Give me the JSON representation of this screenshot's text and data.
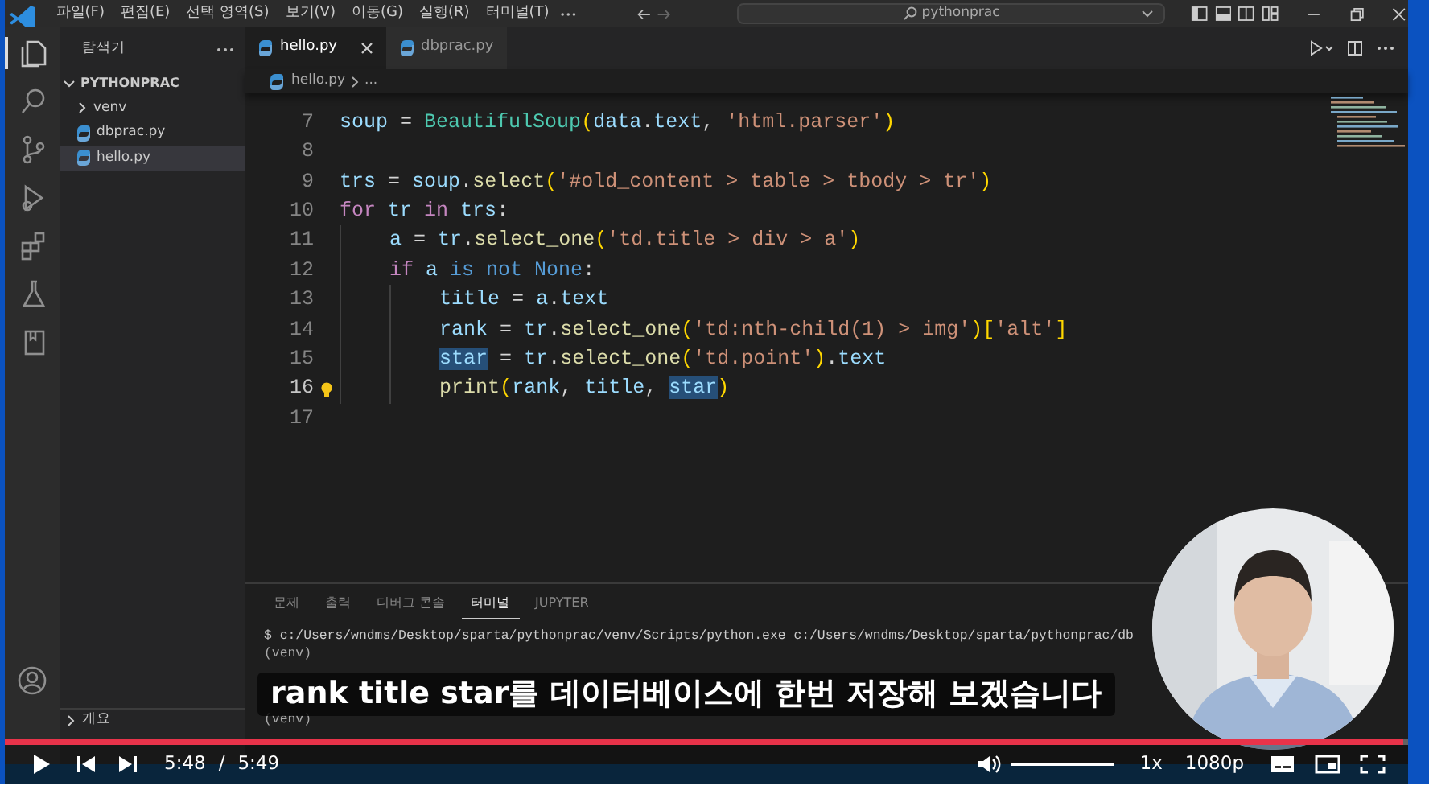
{
  "window": {
    "menu": [
      "파일(F)",
      "편집(E)",
      "선택 영역(S)",
      "보기(V)",
      "이동(G)",
      "실행(R)",
      "터미널(T)"
    ],
    "search": "pythonprac"
  },
  "activity_bar": [
    {
      "kind": "files",
      "selected": true
    },
    {
      "kind": "search",
      "selected": false
    },
    {
      "kind": "branch",
      "selected": false
    },
    {
      "kind": "run",
      "selected": false
    },
    {
      "kind": "blocks",
      "selected": false
    },
    {
      "kind": "flask",
      "selected": false
    },
    {
      "kind": "book",
      "selected": false
    }
  ],
  "explorer": {
    "title": "탐색기",
    "folder": "PYTHONPRAC",
    "expanded": true,
    "items": [
      {
        "label": "venv",
        "kind": "folder",
        "expanded": false,
        "selected": false
      },
      {
        "label": "dbprac.py",
        "kind": "python",
        "selected": false
      },
      {
        "label": "hello.py",
        "kind": "python",
        "selected": true
      }
    ],
    "sections": [
      {
        "label": "개요",
        "expanded": false
      }
    ]
  },
  "tabs": [
    {
      "label": "hello.py",
      "selected": true
    },
    {
      "label": "dbprac.py",
      "selected": false
    }
  ],
  "breadcrumb": {
    "file": "hello.py",
    "rest": "..."
  },
  "code": [
    {
      "no": "7",
      "current": false,
      "lightbulb": false,
      "tokens": [
        {
          "t": "soup",
          "kind": "var"
        },
        {
          "t": " = ",
          "kind": "punct"
        },
        {
          "t": "BeautifulSoup",
          "kind": "class"
        },
        {
          "t": "(",
          "kind": "bracket"
        },
        {
          "t": "data",
          "kind": "var"
        },
        {
          "t": ".",
          "kind": "punct"
        },
        {
          "t": "text",
          "kind": "var"
        },
        {
          "t": ", ",
          "kind": "punct"
        },
        {
          "t": "'html.parser'",
          "kind": "string"
        },
        {
          "t": ")",
          "kind": "bracket"
        }
      ]
    },
    {
      "no": "8",
      "current": false,
      "lightbulb": false
    },
    {
      "no": "9",
      "current": false,
      "lightbulb": false,
      "tokens": [
        {
          "t": "trs",
          "kind": "var"
        },
        {
          "t": " = ",
          "kind": "punct"
        },
        {
          "t": "soup",
          "kind": "var"
        },
        {
          "t": ".",
          "kind": "punct"
        },
        {
          "t": "select",
          "kind": "func"
        },
        {
          "t": "(",
          "kind": "bracket"
        },
        {
          "t": "'#old_content > table > tbody > tr'",
          "kind": "string"
        },
        {
          "t": ")",
          "kind": "bracket"
        }
      ]
    },
    {
      "no": "10",
      "current": false,
      "lightbulb": false,
      "tokens": [
        {
          "t": "for ",
          "kind": "control"
        },
        {
          "t": "tr ",
          "kind": "var"
        },
        {
          "t": "in ",
          "kind": "control"
        },
        {
          "t": "trs",
          "kind": "var"
        },
        {
          "t": ":",
          "kind": "punct"
        }
      ]
    },
    {
      "no": "11",
      "current": false,
      "lightbulb": false,
      "tokens": [
        {
          "t": "    a",
          "kind": "var"
        },
        {
          "t": " = ",
          "kind": "punct"
        },
        {
          "t": "tr",
          "kind": "var"
        },
        {
          "t": ".",
          "kind": "punct"
        },
        {
          "t": "select_one",
          "kind": "func"
        },
        {
          "t": "(",
          "kind": "bracket"
        },
        {
          "t": "'td.title > div > a'",
          "kind": "string"
        },
        {
          "t": ")",
          "kind": "bracket"
        }
      ]
    },
    {
      "no": "12",
      "current": false,
      "lightbulb": false,
      "tokens": [
        {
          "t": "    if ",
          "kind": "control"
        },
        {
          "t": "a ",
          "kind": "var"
        },
        {
          "t": "is not None",
          "kind": "keyword"
        },
        {
          "t": ":",
          "kind": "punct"
        }
      ]
    },
    {
      "no": "13",
      "current": false,
      "lightbulb": false,
      "tokens": [
        {
          "t": "        title",
          "kind": "var"
        },
        {
          "t": " = ",
          "kind": "punct"
        },
        {
          "t": "a",
          "kind": "var"
        },
        {
          "t": ".",
          "kind": "punct"
        },
        {
          "t": "text",
          "kind": "var"
        }
      ]
    },
    {
      "no": "14",
      "current": false,
      "lightbulb": false,
      "tokens": [
        {
          "t": "        rank",
          "kind": "var"
        },
        {
          "t": " = ",
          "kind": "punct"
        },
        {
          "t": "tr",
          "kind": "var"
        },
        {
          "t": ".",
          "kind": "punct"
        },
        {
          "t": "select_one",
          "kind": "func"
        },
        {
          "t": "(",
          "kind": "bracket"
        },
        {
          "t": "'td:nth-child(1) > img'",
          "kind": "string"
        },
        {
          "t": ")[",
          "kind": "bracket"
        },
        {
          "t": "'alt'",
          "kind": "string"
        },
        {
          "t": "]",
          "kind": "bracket"
        }
      ]
    },
    {
      "no": "15",
      "current": false,
      "lightbulb": false,
      "tokens": [
        {
          "t": "        star",
          "kind": "var",
          "highlight": true
        },
        {
          "t": " = ",
          "kind": "punct"
        },
        {
          "t": "tr",
          "kind": "var"
        },
        {
          "t": ".",
          "kind": "punct"
        },
        {
          "t": "select_one",
          "kind": "func"
        },
        {
          "t": "(",
          "kind": "bracket"
        },
        {
          "t": "'td.point'",
          "kind": "string"
        },
        {
          "t": ")",
          "kind": "bracket"
        },
        {
          "t": ".",
          "kind": "punct"
        },
        {
          "t": "text",
          "kind": "var"
        }
      ]
    },
    {
      "no": "16",
      "current": true,
      "lightbulb": true,
      "tokens": [
        {
          "t": "        print",
          "kind": "func"
        },
        {
          "t": "(",
          "kind": "bracket"
        },
        {
          "t": "rank",
          "kind": "var"
        },
        {
          "t": ", ",
          "kind": "punct"
        },
        {
          "t": "title",
          "kind": "var"
        },
        {
          "t": ", ",
          "kind": "punct"
        },
        {
          "t": "star",
          "kind": "var",
          "highlight": true
        },
        {
          "t": ")",
          "kind": "bracket"
        }
      ]
    },
    {
      "no": "17",
      "current": false,
      "lightbulb": false
    }
  ],
  "panel": {
    "tabs": [
      {
        "label": "문제",
        "selected": false
      },
      {
        "label": "출력",
        "selected": false
      },
      {
        "label": "디버그 콘솔",
        "selected": false
      },
      {
        "label": "터미널",
        "selected": true
      },
      {
        "label": "JUPYTER",
        "selected": false
      }
    ],
    "terminal": [
      "$ c:/Users/wndms/Desktop/sparta/pythonprac/venv/Scripts/python.exe c:/Users/wndms/Desktop/sparta/pythonprac/db",
      "(venv)",
      "(venv)"
    ]
  },
  "caption": "rank title star를 데이터베이스에 한번 저장해 보겠습니다",
  "player": {
    "progress": {
      "level": 0.997
    },
    "elapsed": "5:48",
    "separator": "/",
    "duration": "5:49",
    "volume": {
      "level": 1
    },
    "speed": "1x",
    "quality": "1080p"
  }
}
